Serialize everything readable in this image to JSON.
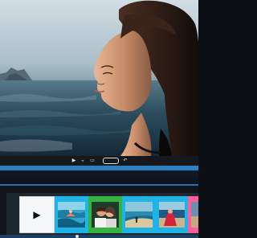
{
  "player": {
    "controls": [
      {
        "name": "play-button",
        "icon": "play-icon",
        "glyph": "▶"
      },
      {
        "name": "split-button",
        "icon": "split-icon",
        "glyph": "⫟"
      },
      {
        "name": "caption-button",
        "icon": "caption-icon",
        "glyph": "▭"
      },
      {
        "name": "timecode-field",
        "icon": "timecode-box-icon"
      },
      {
        "name": "undo-button",
        "icon": "undo-icon",
        "glyph": "↶"
      }
    ]
  },
  "timeline": {
    "scrubber_position": 0.38,
    "clips": [
      {
        "type": "play-card",
        "icon": "play-icon",
        "glyph": "▶",
        "color": "#f5f6f7"
      },
      {
        "type": "video",
        "scene": "surfers",
        "color": "#1fb3e6"
      },
      {
        "type": "video",
        "scene": "couple",
        "color": "#35b341"
      },
      {
        "type": "video",
        "scene": "beach",
        "color": "#1fb3e6"
      },
      {
        "type": "video",
        "scene": "red-dress",
        "color": "#1fb3e6"
      },
      {
        "type": "video",
        "scene": "partial",
        "color": "#ff5c9b"
      }
    ]
  },
  "colors": {
    "accent": "#2e7fc0",
    "clip_blue": "#1fb3e6",
    "clip_green": "#35b341",
    "clip_pink": "#ff5c9b"
  }
}
